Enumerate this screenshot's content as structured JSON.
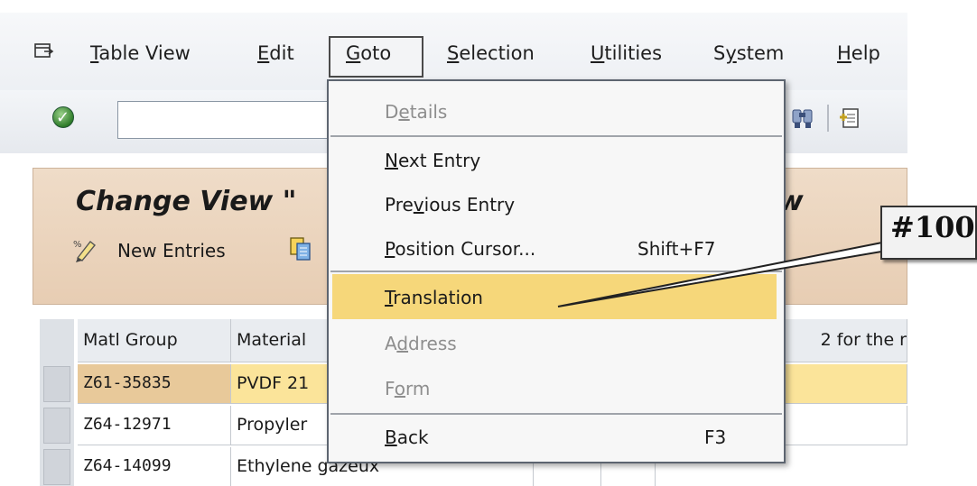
{
  "menubar": {
    "items": [
      {
        "pre": "",
        "ul": "T",
        "post": "able View"
      },
      {
        "pre": "",
        "ul": "E",
        "post": "dit"
      },
      {
        "pre": "",
        "ul": "G",
        "post": "oto"
      },
      {
        "pre": "",
        "ul": "S",
        "post": "election"
      },
      {
        "pre": "",
        "ul": "U",
        "post": "tilities"
      },
      {
        "pre": "S",
        "ul": "y",
        "post": "stem"
      },
      {
        "pre": "",
        "ul": "H",
        "post": "elp"
      }
    ]
  },
  "page": {
    "title_left": "Change View \"",
    "title_right": "w",
    "new_entries_label": "New Entries"
  },
  "table": {
    "headers": [
      "Matl Group",
      "Material",
      "2 for the r"
    ],
    "rows": [
      {
        "group": "Z61-35835",
        "material": "PVDF 21",
        "highlighted": true
      },
      {
        "group": "Z64-12971",
        "material": "Propyler",
        "highlighted": false
      },
      {
        "group": "Z64-14099",
        "material": "Ethylene gazeux",
        "highlighted": false
      }
    ]
  },
  "goto_menu": {
    "items": [
      {
        "pre": "D",
        "ul": "e",
        "post": "tails",
        "shortcut": "",
        "disabled": true
      },
      {
        "pre": "",
        "ul": "N",
        "post": "ext Entry",
        "shortcut": "",
        "disabled": false
      },
      {
        "pre": "Pre",
        "ul": "v",
        "post": "ious Entry",
        "shortcut": "",
        "disabled": false
      },
      {
        "pre": "",
        "ul": "P",
        "post": "osition Cursor...",
        "shortcut": "Shift+F7",
        "disabled": false
      },
      {
        "pre": "",
        "ul": "T",
        "post": "ranslation",
        "shortcut": "",
        "disabled": false,
        "highlighted": true
      },
      {
        "pre": "A",
        "ul": "d",
        "post": "dress",
        "shortcut": "",
        "disabled": true
      },
      {
        "pre": "F",
        "ul": "o",
        "post": "rm",
        "shortcut": "",
        "disabled": true
      },
      {
        "pre": "",
        "ul": "B",
        "post": "ack",
        "shortcut": "F3",
        "disabled": false
      }
    ]
  },
  "callout": {
    "label": "#100"
  },
  "colors": {
    "highlight": "#f6d77a",
    "content_band": "#e9d1b8",
    "row_highlight": "#fbe49a"
  },
  "icons": [
    "menu-icon",
    "check-icon",
    "find-icon",
    "create-session-icon",
    "new-entries-icon",
    "copy-icon"
  ]
}
